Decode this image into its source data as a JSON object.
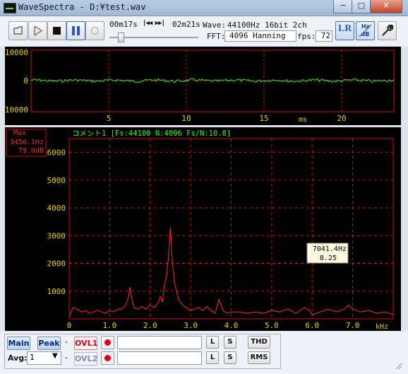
{
  "window": {
    "title": "WaveSpectra - D:¥test.wav",
    "controls": {
      "minimize": "−",
      "maximize": "□",
      "close": "✕"
    }
  },
  "toolbar": {
    "elapsed": "00m17s",
    "seek_glyphs": "|◀◀ ▶▶|",
    "total": "02m21s",
    "wave_label": "Wave:",
    "wave_value": "44100Hz 16bit 2ch",
    "fft_label": "FFT:",
    "fft_value": "4096 Hanning",
    "fps_label": "fps:",
    "fps_value": "72",
    "lr_label": "LR",
    "hz_db_label": "Hz dB",
    "seek_position": 0.1
  },
  "scope": {
    "y_ticks": [
      "10000",
      "0",
      "-10000"
    ],
    "x_ticks": [
      "5",
      "10",
      "15",
      "20"
    ],
    "x_unit": "ms"
  },
  "spectrum": {
    "max_label": "Max",
    "max_freq": "3456.1Hz",
    "max_db": "79.0dB",
    "comment": "コメント1  [Fs:44100 N:4096 Fs/N:10.8]",
    "cursor_freq": "7041.4Hz",
    "cursor_value": "8.25"
  },
  "bottom": {
    "main_label": "Main",
    "peak_label": "Peak",
    "dash": "-",
    "ovl1_label": "OVL1",
    "ovl2_label": "OVL2",
    "l_label": "L",
    "s_label": "S",
    "thd_label": "THD",
    "rms_label": "RMS",
    "avg_label": "Avg:",
    "avg_value": "1"
  },
  "colors": {
    "grid": "#c8141e",
    "scope_trace": "#2ef02e",
    "spectrum_trace": "#ff2a2a",
    "axis_label": "#e8d000",
    "tick_green": "#1ec81e"
  },
  "chart_data": {
    "type": "line",
    "title": "コメント1  [Fs:44100 N:4096 Fs/N:10.8]",
    "xlabel": "kHz",
    "ylabel": "",
    "x_ticks": [
      "0",
      "1.0",
      "2.0",
      "3.0",
      "4.0",
      "5.0",
      "6.0",
      "7.0"
    ],
    "y_ticks": [
      "1000",
      "2000",
      "3000",
      "4000",
      "5000",
      "6000"
    ],
    "xlim": [
      0,
      8.0
    ],
    "ylim": [
      0,
      6500
    ],
    "grid": true,
    "series": [
      {
        "x": [
          0,
          0.1,
          0.2,
          0.3,
          0.4,
          0.5,
          0.6,
          0.7,
          0.8,
          0.9,
          1.0,
          1.1,
          1.2,
          1.3,
          1.4,
          1.45,
          1.5,
          1.55,
          1.6,
          1.7,
          1.8,
          1.9,
          2.0,
          2.1,
          2.2,
          2.25,
          2.3,
          2.35,
          2.4,
          2.45,
          2.5,
          2.55,
          2.6,
          2.65,
          2.7,
          2.8,
          2.9,
          3.0,
          3.1,
          3.2,
          3.3,
          3.4,
          3.5,
          3.6,
          3.7,
          3.8,
          3.9,
          4.0,
          4.2,
          4.4,
          4.6,
          4.8,
          5.0,
          5.2,
          5.4,
          5.6,
          5.8,
          5.9,
          6.0,
          6.2,
          6.4,
          6.6,
          6.8,
          6.9,
          7.0,
          7.2,
          7.4,
          7.6,
          7.8,
          8.0
        ],
        "y": [
          80,
          400,
          350,
          250,
          300,
          200,
          250,
          300,
          250,
          200,
          300,
          250,
          350,
          350,
          500,
          700,
          1150,
          700,
          400,
          350,
          450,
          350,
          500,
          400,
          600,
          800,
          600,
          1200,
          1500,
          2200,
          3300,
          2000,
          1300,
          1000,
          700,
          500,
          400,
          300,
          350,
          400,
          300,
          450,
          300,
          200,
          700,
          300,
          200,
          250,
          250,
          200,
          250,
          200,
          300,
          250,
          350,
          200,
          400,
          350,
          150,
          250,
          350,
          250,
          350,
          500,
          350,
          250,
          300,
          200,
          250,
          150
        ]
      }
    ]
  }
}
